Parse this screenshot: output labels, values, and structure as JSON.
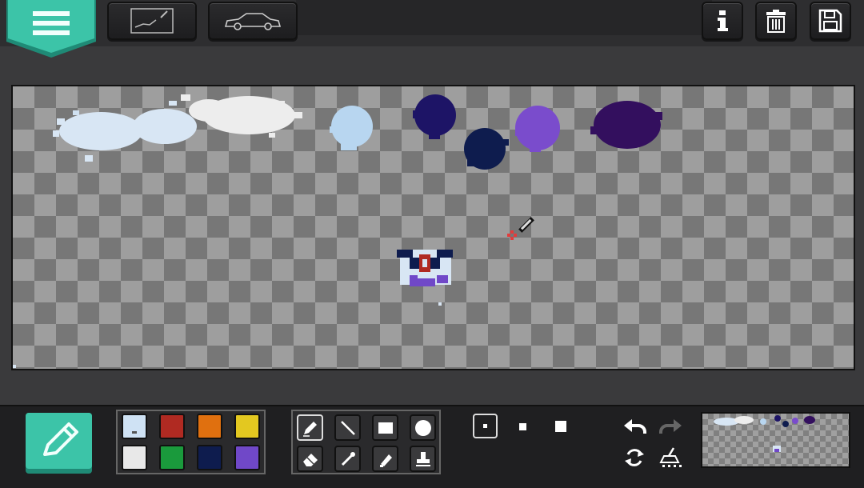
{
  "app": {
    "accent": "#3cc4a8"
  },
  "toolbar": {
    "menu_icon": "hamburger-icon",
    "buttons": [
      {
        "name": "draw-mode-tab",
        "icon": "sketch-frame-icon"
      },
      {
        "name": "vehicle-mode-tab",
        "icon": "car-outline-icon"
      },
      {
        "name": "info-button",
        "icon": "info-icon"
      },
      {
        "name": "delete-button",
        "icon": "trash-icon"
      },
      {
        "name": "save-button",
        "icon": "floppy-disk-icon"
      }
    ]
  },
  "palette": {
    "colors": [
      "#cfe2f4",
      "#b02a22",
      "#e0700f",
      "#e3c820",
      "#e8e8e8",
      "#1a9a3c",
      "#0e1c4e",
      "#7048c8"
    ],
    "selected_index": 0
  },
  "tools": {
    "items": [
      "pencil-tool-icon",
      "line-tool-icon",
      "rectangle-tool-icon",
      "circle-tool-icon",
      "eraser-tool-icon",
      "eyedropper-tool-icon",
      "fill-bucket-tool-icon",
      "stamp-tool-icon"
    ],
    "selected_index": 0
  },
  "brush_sizes": {
    "options": [
      "small",
      "medium",
      "large"
    ],
    "selected": "small"
  },
  "history": {
    "undo_icon": "undo-icon",
    "redo_icon": "redo-icon",
    "redo_enabled": false,
    "rotate_icon": "rotate-icon",
    "clear_icon": "broom-icon"
  },
  "canvas": {
    "blob_colors": [
      "#d8e6f4",
      "#ededed",
      "#b8d6f0",
      "#1d1466",
      "#0e1c4e",
      "#7a4ccc",
      "#330f5e"
    ]
  }
}
